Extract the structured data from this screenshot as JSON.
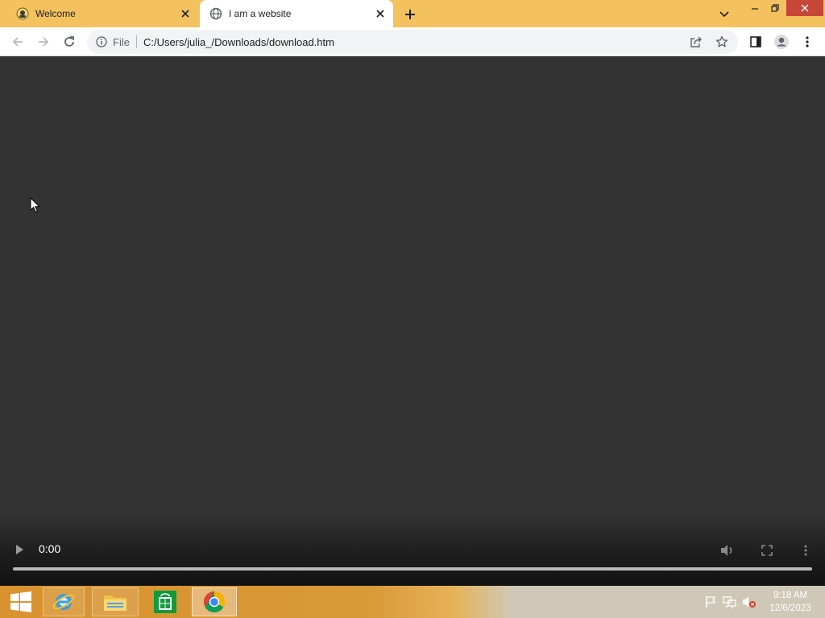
{
  "browser": {
    "tabs": [
      {
        "title": "Welcome",
        "active": false
      },
      {
        "title": "I am a website",
        "active": true
      }
    ],
    "address": {
      "scheme_label": "File",
      "url": "C:/Users/julia_/Downloads/download.htm"
    },
    "accent_color": "#f3c25f"
  },
  "video": {
    "current_time": "0:00",
    "progress": 0
  },
  "taskbar": {
    "pinned": [
      "start-icon",
      "internet-explorer-icon",
      "file-explorer-icon",
      "store-icon",
      "chrome-icon"
    ],
    "clock": {
      "time": "9:18 AM",
      "date": "12/6/2023"
    }
  }
}
